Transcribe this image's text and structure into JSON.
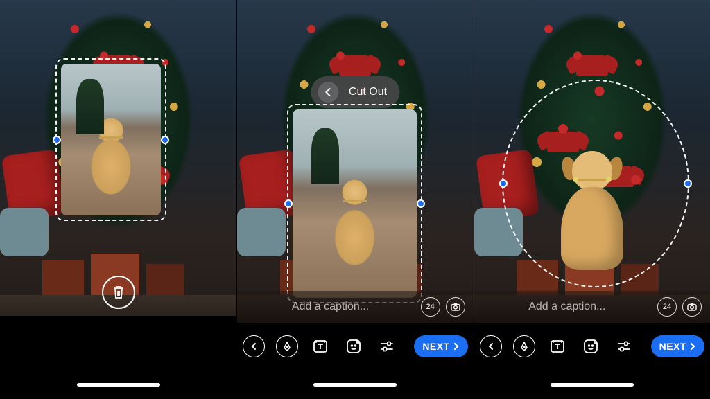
{
  "phone1": {
    "trash_label": "Delete"
  },
  "phone2": {
    "header": {
      "title": "Cut Out"
    },
    "caption_placeholder": "Add a caption...",
    "duration_badge": "24",
    "next_label": "NEXT"
  },
  "phone3": {
    "caption_placeholder": "Add a caption...",
    "duration_badge": "24",
    "next_label": "NEXT"
  }
}
